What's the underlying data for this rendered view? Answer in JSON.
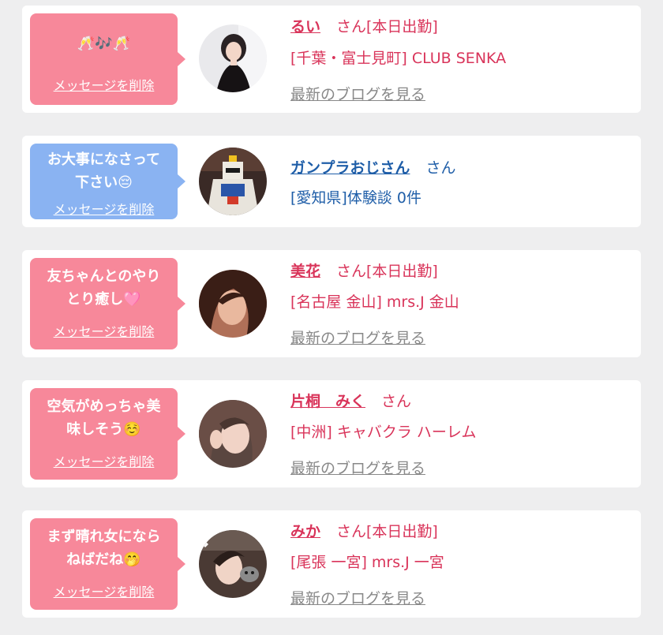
{
  "messages": [
    {
      "bubble_text": "🥂🎶🥂",
      "delete_label": "メッセージを削除",
      "name": "るい",
      "suffix": "さん[本日出勤]",
      "location": "[千葉・富士見町] CLUB SENKA",
      "blog_link": "最新のブログを見る",
      "color": "#d9345a"
    },
    {
      "bubble_text": "お大事になさって\n下さい😔",
      "delete_label": "メッセージを削除",
      "name": "ガンプラおじさん",
      "suffix": "さん",
      "location": "[愛知県]体験談 0件",
      "color": "#1f5ea8"
    },
    {
      "bubble_text": "友ちゃんとのやり\nとり癒し🩷",
      "delete_label": "メッセージを削除",
      "name": "美花",
      "suffix": "さん[本日出勤]",
      "location": "[名古屋 金山] mrs.J 金山",
      "blog_link": "最新のブログを見る",
      "color": "#d9345a"
    },
    {
      "bubble_text": "空気がめっちゃ美\n味しそう☺️",
      "delete_label": "メッセージを削除",
      "name": "片桐　みく",
      "suffix": "さん",
      "location": "[中洲] キャバクラ ハーレム",
      "blog_link": "最新のブログを見る",
      "color": "#d9345a"
    },
    {
      "bubble_text": "まず晴れ女になら\nねばだね🤭",
      "delete_label": "メッセージを削除",
      "name": "みか",
      "suffix": "さん[本日出勤]",
      "location": "[尾張 一宮] mrs.J 一宮",
      "blog_link": "最新のブログを見る",
      "color": "#d9345a"
    }
  ],
  "colors": {
    "pink_bubble": "#f7889a",
    "blue_bubble": "#8ab3f2",
    "pink_text": "#d9345a",
    "blue_text": "#1f5ea8",
    "background": "#eeeeef"
  },
  "icons": {
    "avatar": "avatar-photo-icon"
  }
}
